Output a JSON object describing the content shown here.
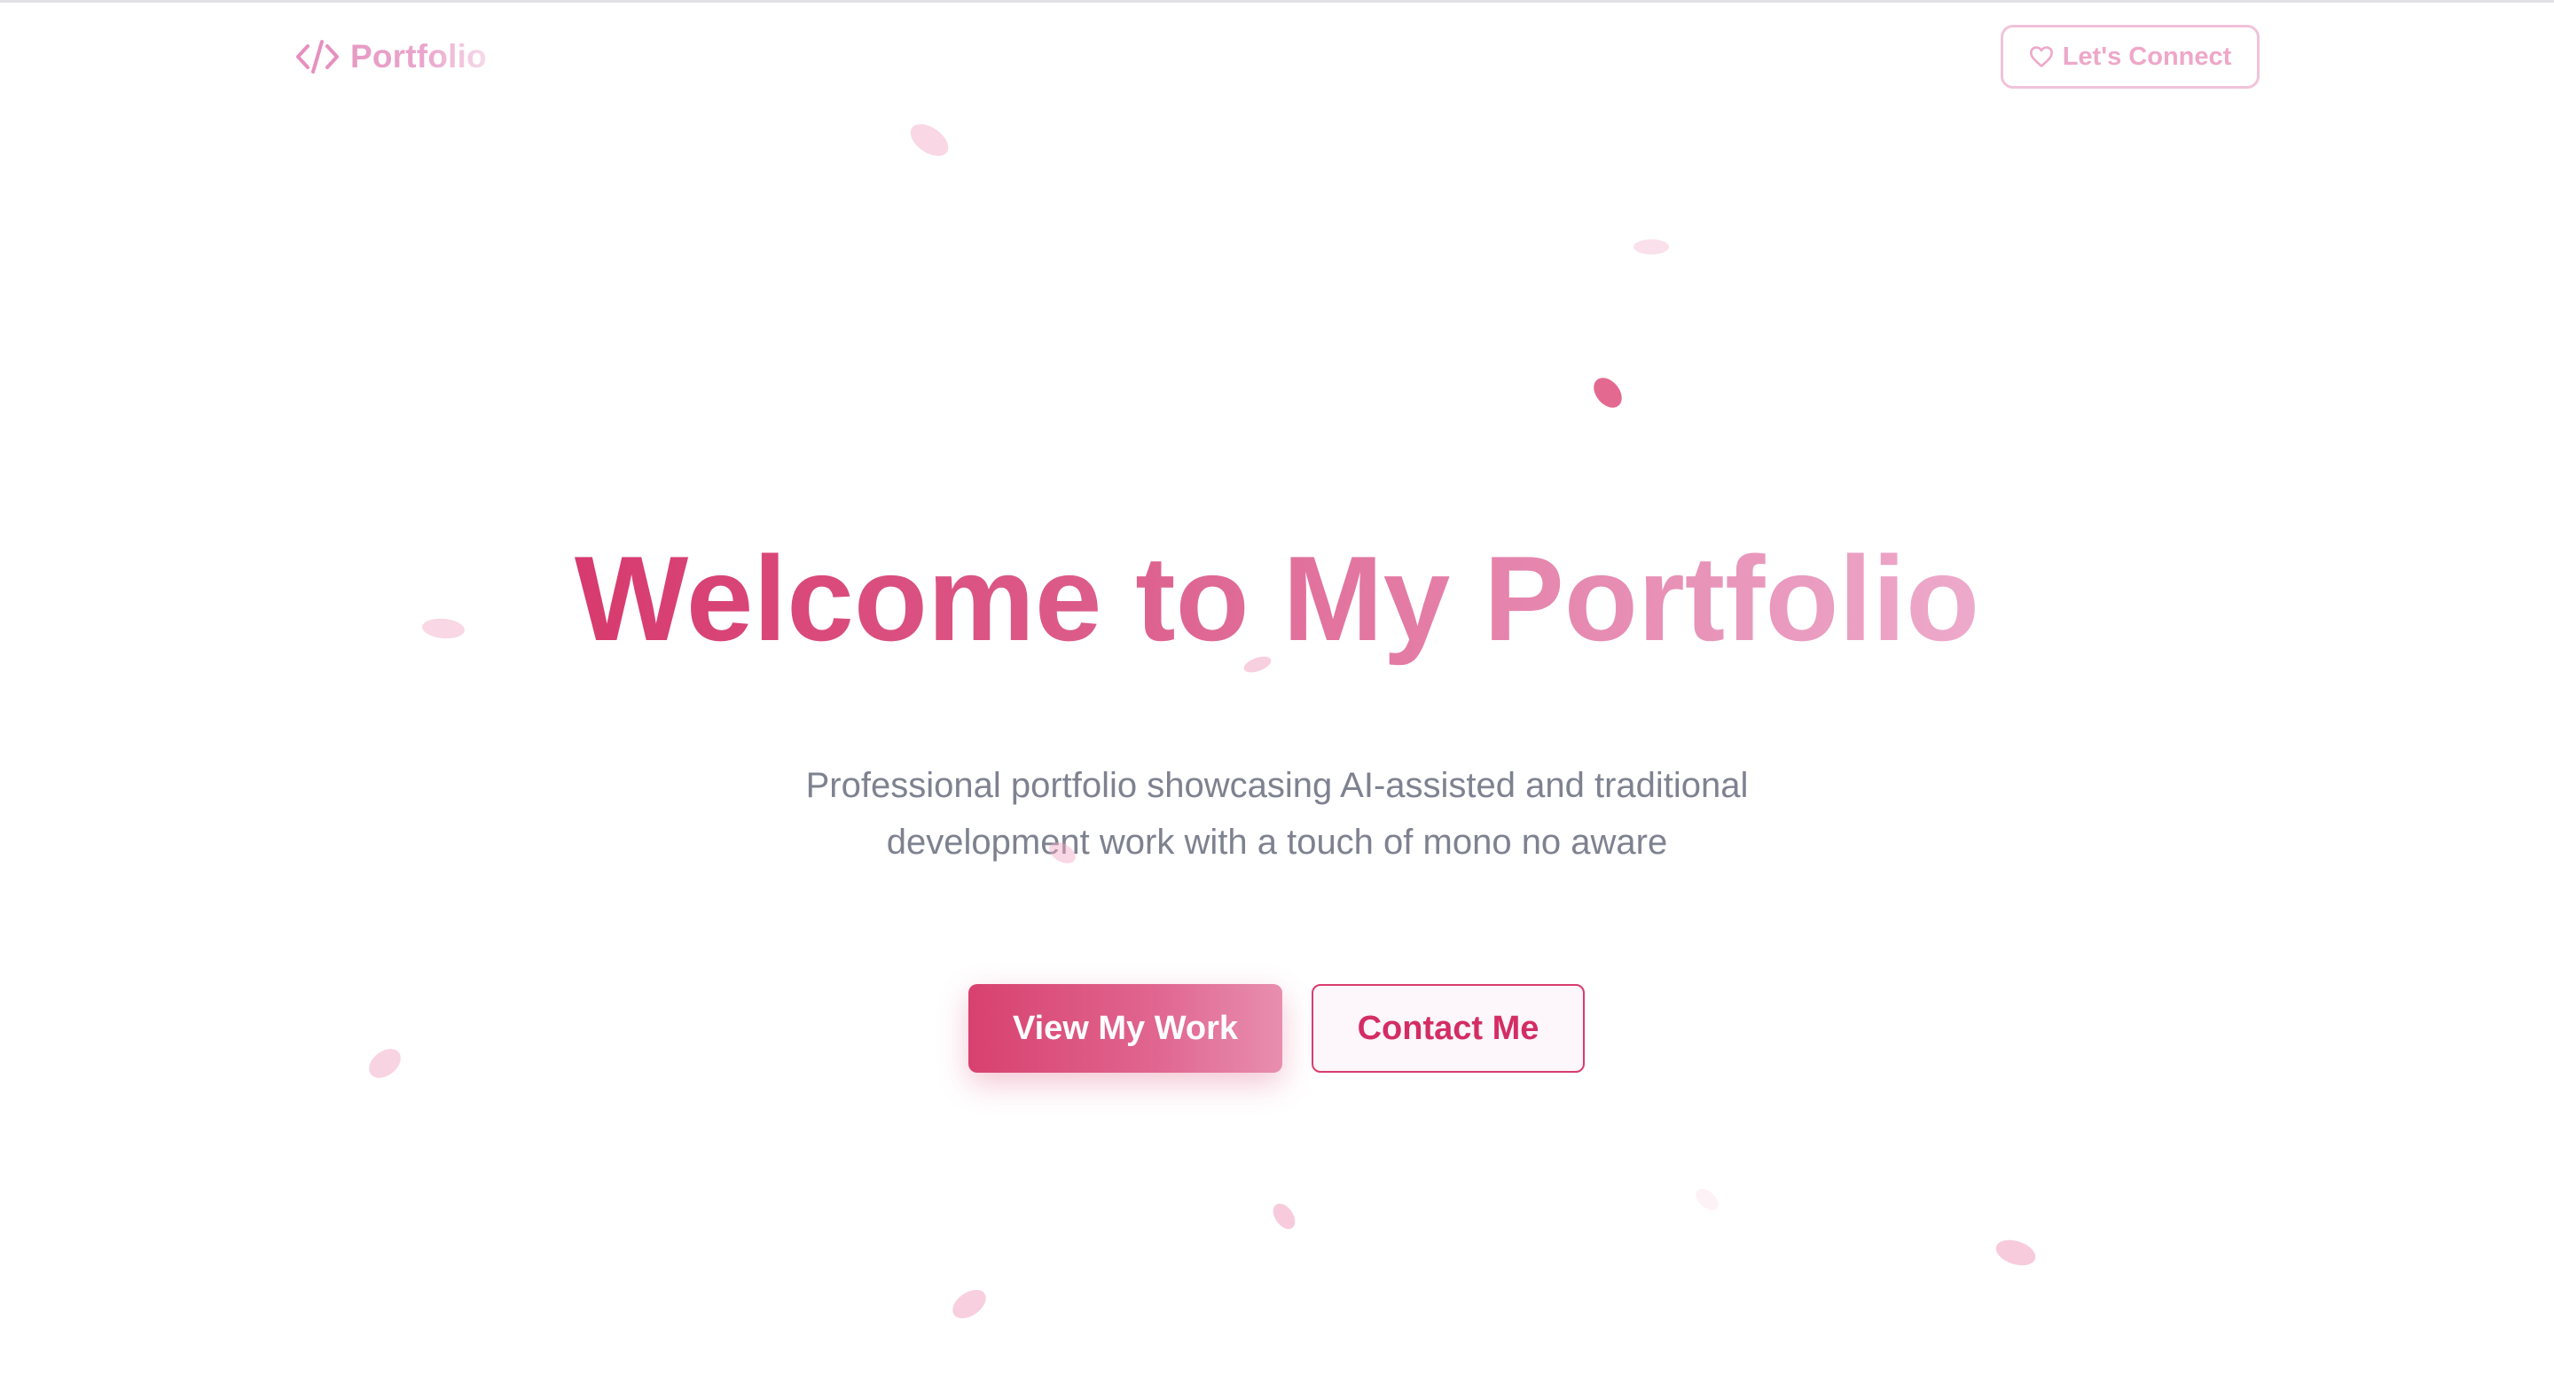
{
  "nav": {
    "logo_icon": "code-icon",
    "logo_text": "Portfolio",
    "connect_icon": "heart-icon",
    "connect_label": "Let's Connect"
  },
  "hero": {
    "title": "Welcome to My Portfolio",
    "subtitle_line1": "Professional portfolio showcasing AI-assisted and traditional",
    "subtitle_line2": "development work with a touch of mono no aware",
    "primary_button": "View My Work",
    "secondary_button": "Contact Me"
  },
  "decorations": {
    "petal_icon": "sakura-petal-icon"
  },
  "colors": {
    "accent": "#d73a6e",
    "accent_light": "#edaacb",
    "petal": "#f2a7c4",
    "subtitle_text": "#7e8290",
    "background": "#ffffff"
  }
}
